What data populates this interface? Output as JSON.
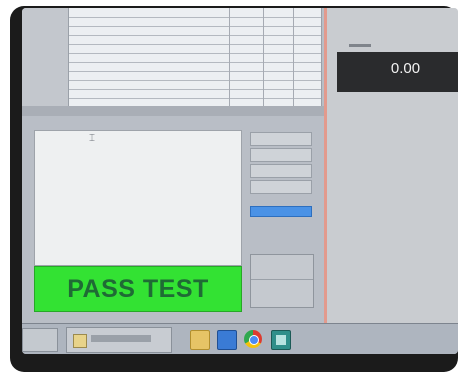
{
  "status": {
    "result_text": "PASS TEST",
    "result_color": "#33e233"
  },
  "readout": {
    "value": "0.00"
  },
  "taskbar": {
    "icons": [
      "folder-icon",
      "app-icon",
      "chrome-icon",
      "calculator-icon"
    ]
  },
  "colors": {
    "pass_green": "#33e233",
    "readout_bg": "#2a2b2d",
    "active_button": "#4a92e6",
    "separator": "#e29a8d"
  }
}
